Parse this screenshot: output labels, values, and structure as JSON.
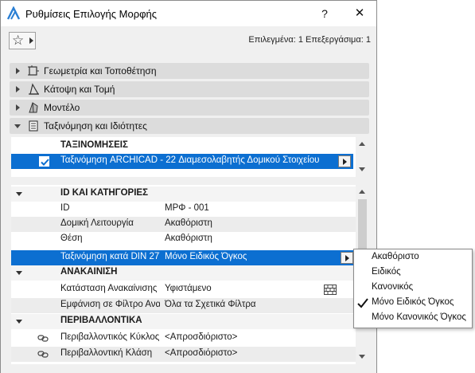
{
  "window": {
    "title": "Ρυθμίσεις Επιλογής Μορφής",
    "help_label": "?",
    "close_label": "✕"
  },
  "toolbar": {
    "favorites_icon": "star-icon",
    "selection_info": "Επιλεγμένα: 1 Επεξεργάσιμα: 1"
  },
  "sections": [
    {
      "label": "Γεωμετρία και Τοποθέτηση",
      "icon": "geometry-icon",
      "expanded": false
    },
    {
      "label": "Κάτοψη και Τομή",
      "icon": "floorplan-icon",
      "expanded": false
    },
    {
      "label": "Μοντέλο",
      "icon": "model-icon",
      "expanded": false
    },
    {
      "label": "Ταξινόμηση και Ιδιότητες",
      "icon": "document-icon",
      "expanded": true
    }
  ],
  "classifications": {
    "header": "ΤΑΞΙΝΟΜΗΣΕΙΣ",
    "row": {
      "checked": true,
      "label": "Ταξινόμηση ARCHICAD - 22 Διαμεσολαβητής Δομικού Στοιχείου"
    }
  },
  "properties": {
    "groups": {
      "ids": "ID ΚΑΙ ΚΑΤΗΓΟΡΙΕΣ",
      "renovation": "ΑΝΑΚΑΙΝΙΣΗ",
      "environmental": "ΠΕΡΙΒΑΛΛΟΝΤΙΚΑ"
    },
    "rows": [
      {
        "name": "ID",
        "value": "ΜΡΦ - 001"
      },
      {
        "name": "Δομική Λειτουργία",
        "value": "Ακαθόριστη"
      },
      {
        "name": "Θέση",
        "value": "Ακαθόριστη"
      },
      {
        "name": "Ταξινόμηση κατά DIN 277",
        "value": "Μόνο Ειδικός Όγκος"
      },
      {
        "name": "Κατάσταση Ανακαίνισης",
        "value": "Υφιστάμενο"
      },
      {
        "name": "Εμφάνιση σε Φίλτρο Ανα...",
        "value": "Όλα τα Σχετικά Φίλτρα"
      },
      {
        "name": "Περιβαλλοντικός Κύκλος ...",
        "value": "<Απροσδιόριστο>"
      },
      {
        "name": "Περιβαλλοντική Κλάση",
        "value": "<Απροσδιόριστο>"
      }
    ]
  },
  "dropdown": {
    "options": [
      "Ακαθόριστο",
      "Ειδικός",
      "Κανονικός",
      "Μόνο Ειδικός Όγκος",
      "Μόνο Κανονικός Όγκος"
    ],
    "selected": "Μόνο Ειδικός Όγκος"
  },
  "colors": {
    "selection": "#0c6fd1",
    "section_bar": "#dcdcdc"
  }
}
